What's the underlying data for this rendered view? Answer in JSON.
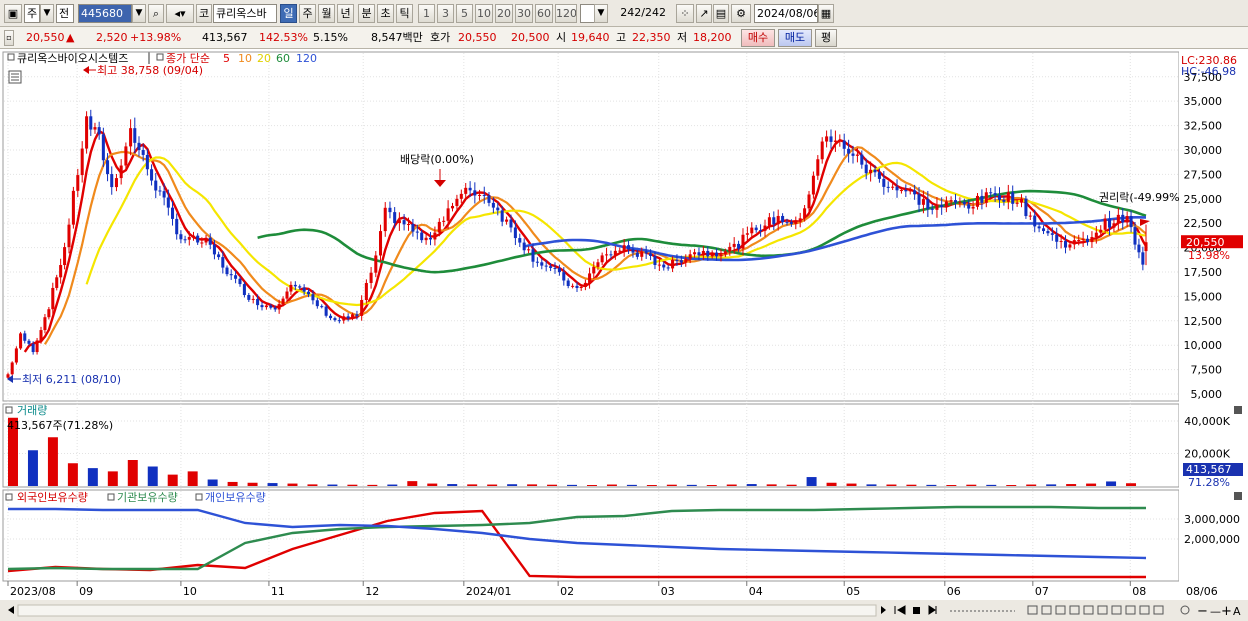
{
  "toolbar": {
    "market_label": "주",
    "prev_label": "전",
    "code": "445680",
    "category_label": "코",
    "stock_name": "큐리옥스바",
    "periods": [
      "일",
      "주",
      "월",
      "년",
      "분",
      "초",
      "틱"
    ],
    "active_period": "일",
    "multipliers": [
      "1",
      "3",
      "5",
      "10",
      "20",
      "30",
      "60",
      "120"
    ],
    "count": "242",
    "count_total": "/242",
    "date": "2024/08/06"
  },
  "quote": {
    "price": "20,550",
    "change": "2,520",
    "change_pct": "+13.98%",
    "volume": "413,567",
    "volume_ratio": "142.53%",
    "turnover_pct": "5.15%",
    "amount": "8,547백만",
    "bid_label": "호가",
    "ask": "20,550",
    "bid": "20,500",
    "open_label": "시",
    "open": "19,640",
    "high_label": "고",
    "high": "22,350",
    "low_label": "저",
    "low": "18,200",
    "buy_label": "매수",
    "sell_label": "매도",
    "avg_label": "평"
  },
  "colors": {
    "up": "#e00000",
    "down": "#1030c0",
    "ma5": "#e00000",
    "ma10": "#f08a1c",
    "ma20": "#f5e600",
    "ma60": "#1e8c3a",
    "ma120": "#2e52d6",
    "foreign": "#e00000",
    "institution": "#2e8b4f",
    "individual": "#2e52d6"
  },
  "chart_data": [
    {
      "type": "candlestick",
      "title": "큐리옥스바이오시스템즈",
      "legend": [
        "종가 단순",
        "5",
        "10",
        "20",
        "60",
        "120"
      ],
      "annotations": {
        "high": "최고 38,758 (09/04)",
        "low": "최저 6,211 (08/10)",
        "dividend": "배당락(0.00%)",
        "rights": "권리락(-49.99%"
      },
      "scale_labels": {
        "lc": "LC:230.86",
        "hc": "HC:-46.98"
      },
      "price_tag": "20,550",
      "price_tag_pct": "13.98%",
      "ylim": [
        5000,
        38500
      ],
      "y_ticks": [
        "37,500",
        "35,000",
        "32,500",
        "30,000",
        "27,500",
        "25,000",
        "22,500",
        "20,000",
        "17,500",
        "15,000",
        "12,500",
        "10,000",
        "7,500",
        "5,000"
      ],
      "x_tick_labels": [
        "2023/08",
        "09",
        "10",
        "11",
        "12",
        "2024/01",
        "02",
        "03",
        "04",
        "05",
        "06",
        "07",
        "08"
      ],
      "close_series": [
        {
          "date": "2023-08-10",
          "close": 7000
        },
        {
          "date": "2023-08-14",
          "close": 11000
        },
        {
          "date": "2023-08-18",
          "close": 9500
        },
        {
          "date": "2023-08-23",
          "close": 14000
        },
        {
          "date": "2023-08-28",
          "close": 20000
        },
        {
          "date": "2023-09-04",
          "close": 33000
        },
        {
          "date": "2023-09-08",
          "close": 31000
        },
        {
          "date": "2023-09-12",
          "close": 26000
        },
        {
          "date": "2023-09-18",
          "close": 32000
        },
        {
          "date": "2023-09-22",
          "close": 29000
        },
        {
          "date": "2023-10-04",
          "close": 21000
        },
        {
          "date": "2023-10-12",
          "close": 20500
        },
        {
          "date": "2023-10-20",
          "close": 17000
        },
        {
          "date": "2023-10-27",
          "close": 14500
        },
        {
          "date": "2023-11-03",
          "close": 13800
        },
        {
          "date": "2023-11-08",
          "close": 16500
        },
        {
          "date": "2023-11-15",
          "close": 14500
        },
        {
          "date": "2023-11-22",
          "close": 12500
        },
        {
          "date": "2023-11-29",
          "close": 13000
        },
        {
          "date": "2023-12-05",
          "close": 19000
        },
        {
          "date": "2023-12-08",
          "close": 23500
        },
        {
          "date": "2023-12-14",
          "close": 22500
        },
        {
          "date": "2023-12-21",
          "close": 20500
        },
        {
          "date": "2023-12-28",
          "close": 24000
        },
        {
          "date": "2024-01-04",
          "close": 26000
        },
        {
          "date": "2024-01-10",
          "close": 25000
        },
        {
          "date": "2024-01-17",
          "close": 22000
        },
        {
          "date": "2024-01-24",
          "close": 19000
        },
        {
          "date": "2024-01-31",
          "close": 17500
        },
        {
          "date": "2024-02-07",
          "close": 15500
        },
        {
          "date": "2024-02-15",
          "close": 19000
        },
        {
          "date": "2024-02-22",
          "close": 20000
        },
        {
          "date": "2024-02-29",
          "close": 19000
        },
        {
          "date": "2024-03-07",
          "close": 18000
        },
        {
          "date": "2024-03-14",
          "close": 19500
        },
        {
          "date": "2024-03-21",
          "close": 19500
        },
        {
          "date": "2024-03-28",
          "close": 20000
        },
        {
          "date": "2024-04-04",
          "close": 22000
        },
        {
          "date": "2024-04-11",
          "close": 23000
        },
        {
          "date": "2024-04-18",
          "close": 22500
        },
        {
          "date": "2024-04-25",
          "close": 31000
        },
        {
          "date": "2024-05-02",
          "close": 30500
        },
        {
          "date": "2024-05-09",
          "close": 28000
        },
        {
          "date": "2024-05-16",
          "close": 26500
        },
        {
          "date": "2024-05-23",
          "close": 25500
        },
        {
          "date": "2024-05-30",
          "close": 24000
        },
        {
          "date": "2024-06-05",
          "close": 24500
        },
        {
          "date": "2024-06-12",
          "close": 24500
        },
        {
          "date": "2024-06-19",
          "close": 25500
        },
        {
          "date": "2024-06-26",
          "close": 25000
        },
        {
          "date": "2024-07-03",
          "close": 22000
        },
        {
          "date": "2024-07-10",
          "close": 20500
        },
        {
          "date": "2024-07-17",
          "close": 20500
        },
        {
          "date": "2024-07-24",
          "close": 22500
        },
        {
          "date": "2024-07-31",
          "close": 23000
        },
        {
          "date": "2024-08-05",
          "close": 18030
        },
        {
          "date": "2024-08-06",
          "close": 20550
        }
      ]
    },
    {
      "type": "bar",
      "title": "거래량",
      "readout": "413,567주(71.28%)",
      "y_ticks": [
        "40,000K",
        "20,000K"
      ],
      "value_tag": "413,567",
      "value_tag_pct": "71.28%",
      "values_k": [
        42000,
        22000,
        30000,
        14000,
        11000,
        9000,
        16000,
        12000,
        7000,
        9000,
        4000,
        2500,
        2000,
        1800,
        1500,
        1000,
        900,
        800,
        700,
        900,
        3000,
        1500,
        1200,
        1000,
        900,
        1100,
        1000,
        800,
        700,
        600,
        900,
        700,
        600,
        800,
        700,
        600,
        900,
        1200,
        1000,
        800,
        5500,
        2000,
        1500,
        1000,
        900,
        800,
        700,
        600,
        800,
        700,
        600,
        900,
        1000,
        1200,
        1500,
        2800,
        1700
      ]
    },
    {
      "type": "line",
      "legend": [
        "외국인보유수량",
        "기관보유수량",
        "개인보유수량"
      ],
      "y_ticks": [
        "3,000,000",
        "2,000,000"
      ],
      "series": [
        {
          "name": "외국인보유수량",
          "values": [
            400000,
            600000,
            500000,
            450000,
            700000,
            550000,
            1500000,
            2200000,
            2900000,
            3300000,
            3400000,
            150000,
            100000,
            100000,
            100000,
            100000,
            100000,
            100000,
            100000,
            100000,
            100000,
            100000,
            100000,
            100000,
            100000
          ]
        },
        {
          "name": "기관보유수량",
          "values": [
            500000,
            550000,
            500000,
            500000,
            500000,
            1800000,
            2300000,
            2500000,
            2600000,
            2650000,
            2700000,
            2800000,
            3100000,
            3150000,
            3400000,
            3450000,
            3450000,
            3450000,
            3500000,
            3550000,
            3600000,
            3600000,
            3600000,
            3550000,
            3550000
          ]
        },
        {
          "name": "개인보유수량",
          "values": [
            3500000,
            3500000,
            3450000,
            3450000,
            3450000,
            2800000,
            2600000,
            2700000,
            2650000,
            2500000,
            2300000,
            2000000,
            1800000,
            1700000,
            1600000,
            1500000,
            1450000,
            1400000,
            1350000,
            1300000,
            1250000,
            1200000,
            1150000,
            1100000,
            1050000
          ]
        }
      ],
      "x_extra_label": "08/06"
    }
  ]
}
